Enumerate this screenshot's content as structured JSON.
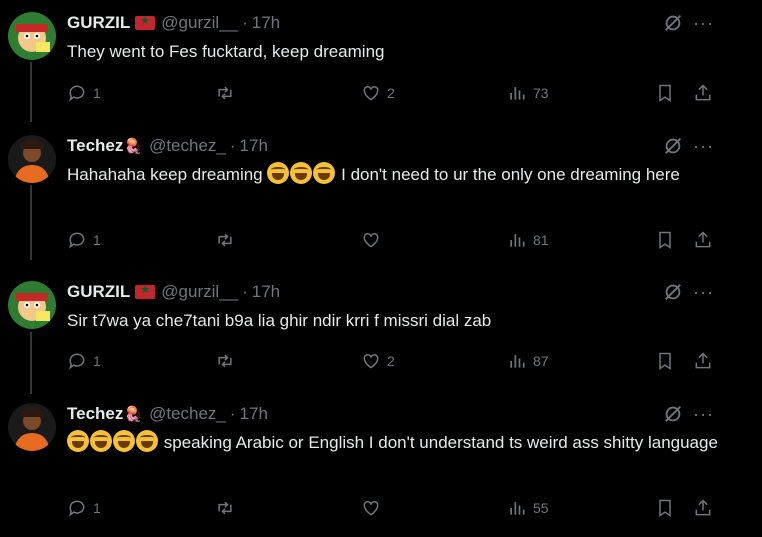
{
  "tweets": [
    {
      "name": "GURZIL",
      "handle": "@gurzil__",
      "time": "17h",
      "text": "They went to Fes fucktard, keep dreaming",
      "replies": "1",
      "reposts": "",
      "likes": "2",
      "views": "73",
      "flag": "morocco-flag"
    },
    {
      "name": "Techez",
      "handle": "@techez_",
      "time": "17h",
      "text_before": "Hahahaha keep dreaming",
      "text": "I don't need to ur the only one dreaming here",
      "emoji_count": 3,
      "replies": "1",
      "reposts": "",
      "likes": "",
      "views": "81",
      "badge": "jellyfish-emoji"
    },
    {
      "name": "GURZIL",
      "handle": "@gurzil__",
      "time": "17h",
      "text": "Sir t7wa ya che7tani b9a lia ghir ndir krri f missri dial zab",
      "replies": "1",
      "reposts": "",
      "likes": "2",
      "views": "87",
      "flag": "morocco-flag"
    },
    {
      "name": "Techez",
      "handle": "@techez_",
      "time": "17h",
      "text": "speaking Arabic or English I don't understand ts weird ass shitty language",
      "emoji_count": 4,
      "replies": "1",
      "reposts": "",
      "likes": "",
      "views": "55",
      "badge": "jellyfish-emoji"
    }
  ],
  "more_label": "···",
  "dot": "·",
  "colors": {
    "background": "#000000",
    "text": "#e7e9ea",
    "muted": "#71767b",
    "line": "#333639"
  }
}
